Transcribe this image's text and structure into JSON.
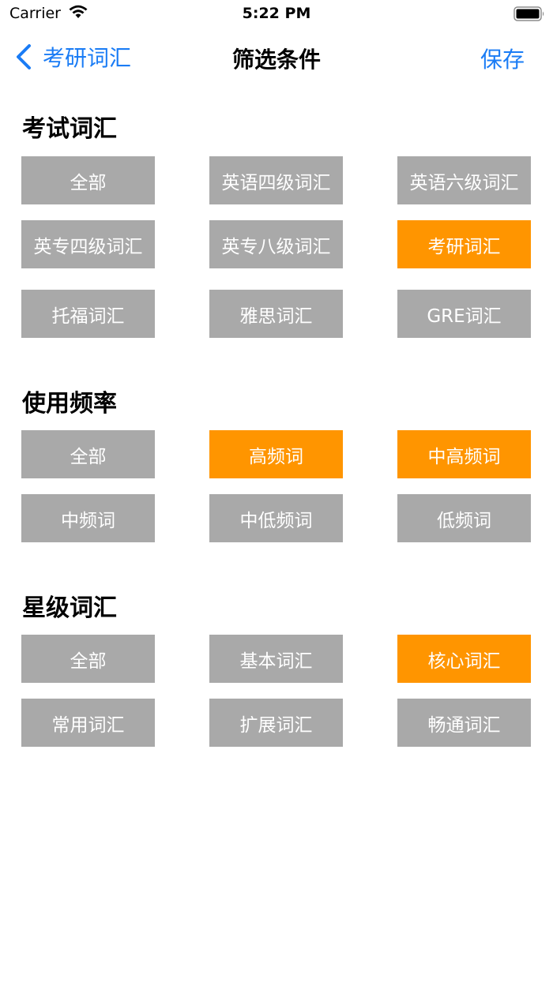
{
  "status_bar": {
    "carrier": "Carrier",
    "time": "5:22 PM"
  },
  "nav": {
    "back_label": "考研词汇",
    "title": "筛选条件",
    "save_label": "保存"
  },
  "colors": {
    "accent": "#1a7cf5",
    "chip_default": "#a9a9a9",
    "chip_selected": "#ff9500"
  },
  "sections": [
    {
      "title": "考试词汇",
      "options": [
        {
          "label": "全部",
          "selected": false
        },
        {
          "label": "英语四级词汇",
          "selected": false
        },
        {
          "label": "英语六级词汇",
          "selected": false
        },
        {
          "label": "英专四级词汇",
          "selected": false
        },
        {
          "label": "英专八级词汇",
          "selected": false
        },
        {
          "label": "考研词汇",
          "selected": true
        },
        {
          "label": "托福词汇",
          "selected": false
        },
        {
          "label": "雅思词汇",
          "selected": false
        },
        {
          "label": "GRE词汇",
          "selected": false
        }
      ]
    },
    {
      "title": "使用频率",
      "options": [
        {
          "label": "全部",
          "selected": false
        },
        {
          "label": "高频词",
          "selected": true
        },
        {
          "label": "中高频词",
          "selected": true
        },
        {
          "label": "中频词",
          "selected": false
        },
        {
          "label": "中低频词",
          "selected": false
        },
        {
          "label": "低频词",
          "selected": false
        }
      ]
    },
    {
      "title": "星级词汇",
      "options": [
        {
          "label": "全部",
          "selected": false
        },
        {
          "label": "基本词汇",
          "selected": false
        },
        {
          "label": "核心词汇",
          "selected": true
        },
        {
          "label": "常用词汇",
          "selected": false
        },
        {
          "label": "扩展词汇",
          "selected": false
        },
        {
          "label": "畅通词汇",
          "selected": false
        }
      ]
    }
  ]
}
